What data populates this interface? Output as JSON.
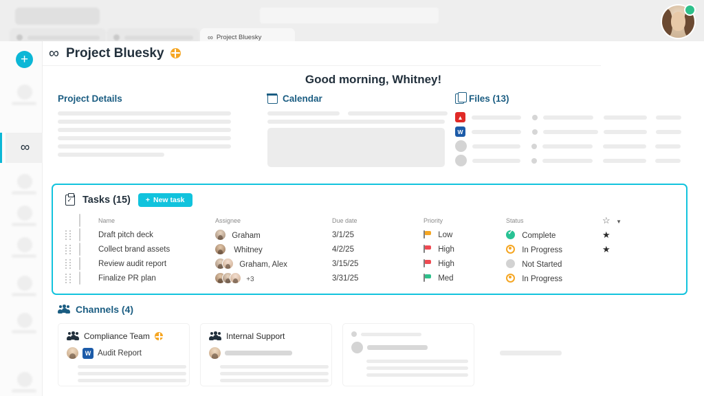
{
  "browser": {
    "active_tab": {
      "label": "Project Bluesky",
      "icon": "infinity-icon"
    }
  },
  "user": {
    "avatar_icon": "user-avatar",
    "presence": "online",
    "presence_color": "#2ec08b"
  },
  "sidebar": {
    "add_button_label": "+",
    "active_item_icon": "infinity-icon"
  },
  "header": {
    "icon": "infinity-icon",
    "title": "Project Bluesky",
    "visibility_icon": "globe-icon",
    "visibility_color": "#f5a623"
  },
  "greeting": "Good morning, Whitney!",
  "cards": {
    "project_details": {
      "title": "Project Details"
    },
    "calendar": {
      "title": "Calendar",
      "icon": "calendar-icon"
    },
    "files": {
      "title": "Files (13)",
      "icon": "file-icon",
      "rows": [
        {
          "badge": "PDF",
          "badge_short": "",
          "type": "pdf"
        },
        {
          "badge": "DOC",
          "badge_short": "W",
          "type": "doc"
        },
        {
          "badge": "",
          "badge_short": "",
          "type": "blank"
        },
        {
          "badge": "",
          "badge_short": "",
          "type": "blank"
        }
      ]
    }
  },
  "tasks": {
    "icon": "clipboard-check-icon",
    "title": "Tasks (15)",
    "new_task_label": "New task",
    "new_task_icon": "plus-icon",
    "accent_color": "#11c3dd",
    "columns": {
      "name": "Name",
      "assignee": "Assignee",
      "due_date": "Due date",
      "priority": "Priority",
      "status": "Status",
      "star": "star-icon"
    },
    "rows": [
      {
        "name": "Draft pitch deck",
        "assignee": "Graham",
        "assignee_count": 1,
        "due_date": "3/1/25",
        "priority": "Low",
        "priority_color": "#f5a623",
        "status": "Complete",
        "status_type": "done",
        "starred": true
      },
      {
        "name": "Collect brand assets",
        "assignee": "Whitney",
        "assignee_count": 1,
        "due_date": "4/2/25",
        "priority": "High",
        "priority_color": "#ef4a52",
        "status": "In Progress",
        "status_type": "prog",
        "starred": true
      },
      {
        "name": "Review audit report",
        "assignee": "Graham, Alex",
        "assignee_count": 2,
        "due_date": "3/15/25",
        "priority": "High",
        "priority_color": "#ef4a52",
        "status": "Not Started",
        "status_type": "none",
        "starred": false
      },
      {
        "name": "Finalize PR plan",
        "assignee": "+3",
        "assignee_count": 3,
        "due_date": "3/31/25",
        "priority": "Med",
        "priority_color": "#2ec08b",
        "status": "In Progress",
        "status_type": "prog",
        "starred": false
      }
    ]
  },
  "channels": {
    "icon": "people-icon",
    "title": "Channels (4)",
    "items": [
      {
        "name": "Compliance Team",
        "has_globe": true,
        "file_label": "Audit Report",
        "file_badge": "W"
      },
      {
        "name": "Internal Support",
        "has_globe": false,
        "file_label": "",
        "file_badge": ""
      }
    ]
  }
}
